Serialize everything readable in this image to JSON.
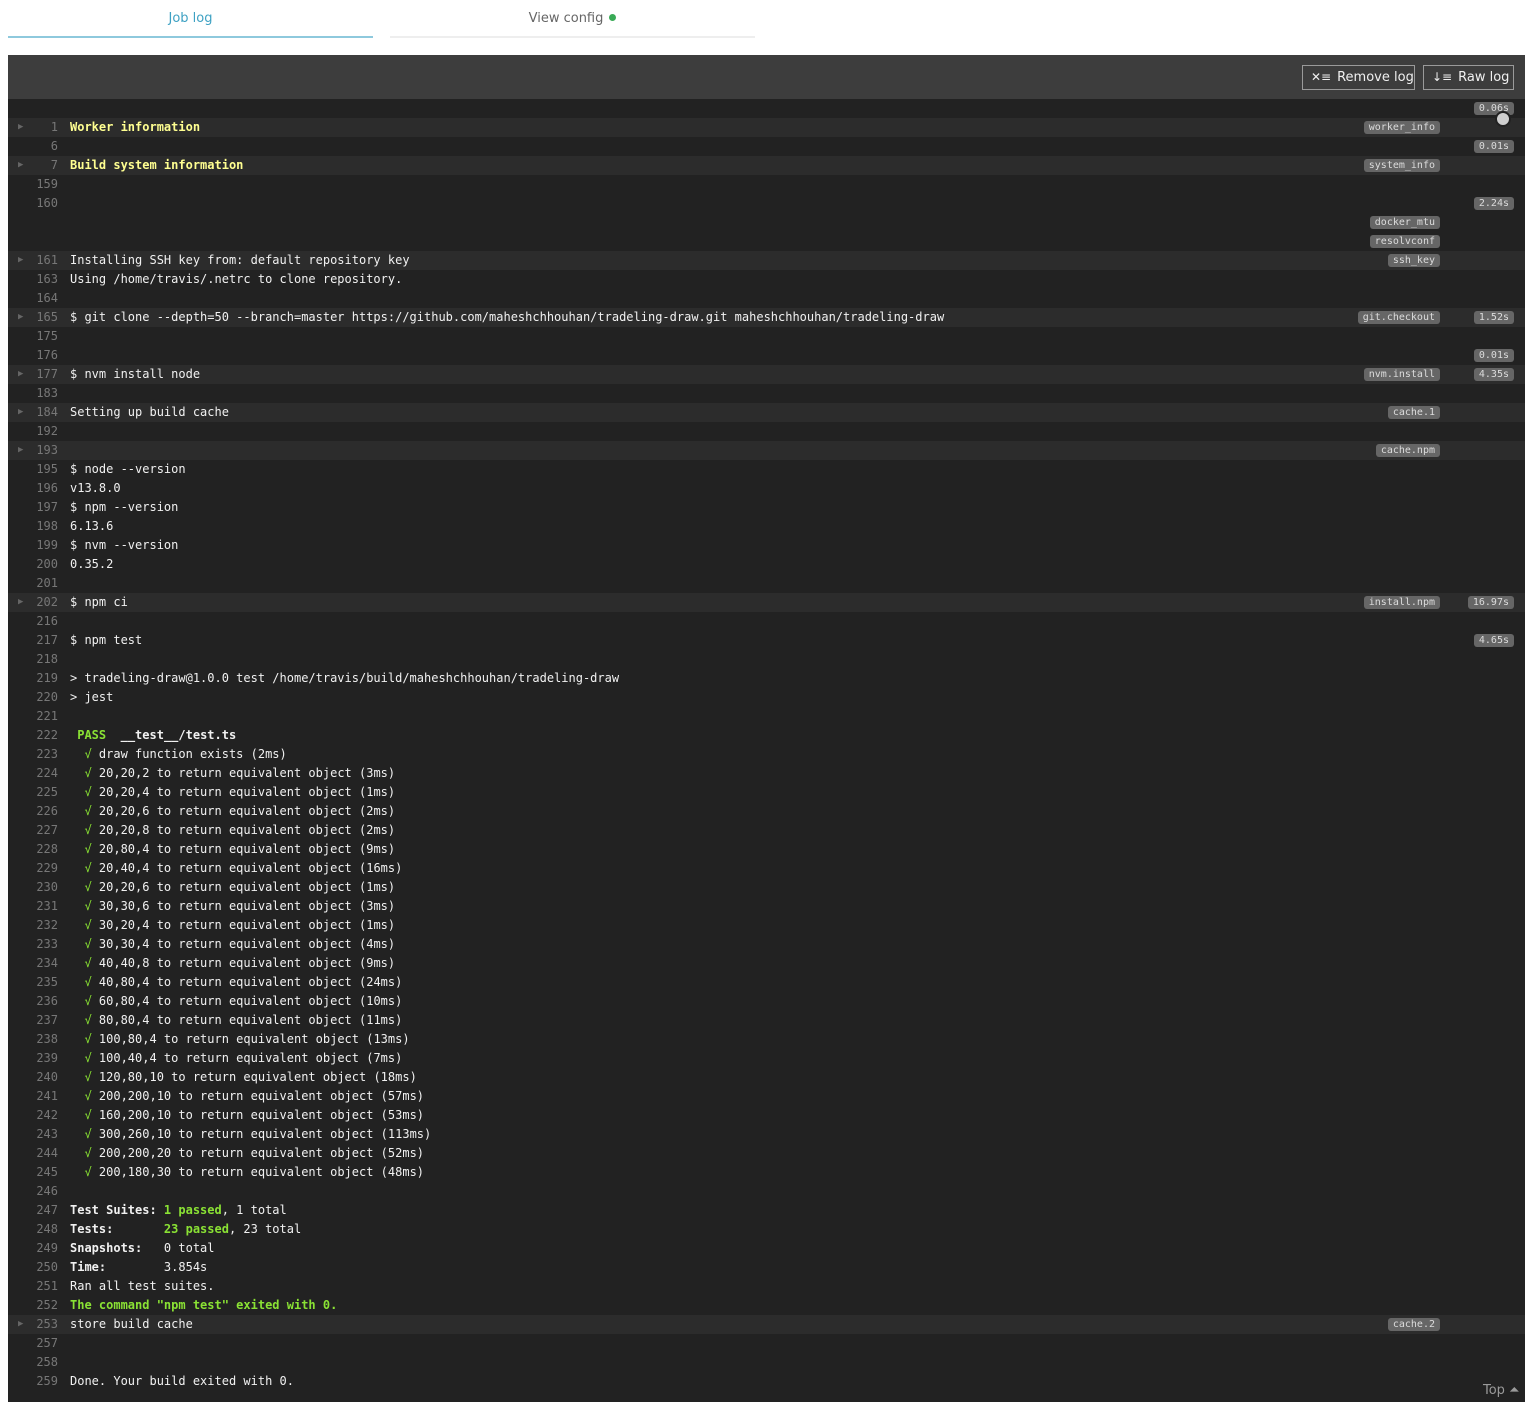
{
  "tabs": {
    "job_log": "Job log",
    "view_config": "View config"
  },
  "toolbar": {
    "remove_log": "Remove log",
    "raw_log": "Raw log"
  },
  "footer": {
    "top": "Top"
  },
  "lines": [
    {
      "n": "",
      "segs": [],
      "time": "0.06s"
    },
    {
      "n": "1",
      "fold": true,
      "segs": [
        {
          "t": "Worker information",
          "c": "yel"
        }
      ],
      "tag": "worker_info"
    },
    {
      "n": "6",
      "segs": [],
      "time": "0.01s"
    },
    {
      "n": "7",
      "fold": true,
      "segs": [
        {
          "t": "Build system information",
          "c": "yel"
        }
      ],
      "tag": "system_info"
    },
    {
      "n": "159",
      "segs": []
    },
    {
      "n": "160",
      "segs": [],
      "time": "2.24s"
    },
    {
      "n": "",
      "segs": [],
      "tag": "docker_mtu"
    },
    {
      "n": "",
      "segs": [],
      "tag": "resolvconf"
    },
    {
      "n": "161",
      "fold": true,
      "segs": [
        {
          "t": "Installing SSH key from: default repository key"
        }
      ],
      "tag": "ssh_key"
    },
    {
      "n": "163",
      "segs": [
        {
          "t": "Using /home/travis/.netrc to clone repository."
        }
      ]
    },
    {
      "n": "164",
      "segs": []
    },
    {
      "n": "165",
      "fold": true,
      "segs": [
        {
          "t": "$ git clone --depth=50 --branch=master https://github.com/maheshchhouhan/tradeling-draw.git maheshchhouhan/tradeling-draw"
        }
      ],
      "tag": "git.checkout",
      "time": "1.52s"
    },
    {
      "n": "175",
      "segs": []
    },
    {
      "n": "176",
      "segs": [],
      "time": "0.01s"
    },
    {
      "n": "177",
      "fold": true,
      "segs": [
        {
          "t": "$ nvm install node"
        }
      ],
      "tag": "nvm.install",
      "time": "4.35s"
    },
    {
      "n": "183",
      "segs": []
    },
    {
      "n": "184",
      "fold": true,
      "segs": [
        {
          "t": "Setting up build cache"
        }
      ],
      "tag": "cache.1"
    },
    {
      "n": "192",
      "segs": []
    },
    {
      "n": "193",
      "fold": true,
      "segs": [],
      "tag": "cache.npm"
    },
    {
      "n": "195",
      "segs": [
        {
          "t": "$ node --version"
        }
      ]
    },
    {
      "n": "196",
      "segs": [
        {
          "t": "v13.8.0"
        }
      ]
    },
    {
      "n": "197",
      "segs": [
        {
          "t": "$ npm --version"
        }
      ]
    },
    {
      "n": "198",
      "segs": [
        {
          "t": "6.13.6"
        }
      ]
    },
    {
      "n": "199",
      "segs": [
        {
          "t": "$ nvm --version"
        }
      ]
    },
    {
      "n": "200",
      "segs": [
        {
          "t": "0.35.2"
        }
      ]
    },
    {
      "n": "201",
      "segs": []
    },
    {
      "n": "202",
      "fold": true,
      "segs": [
        {
          "t": "$ npm ci"
        }
      ],
      "tag": "install.npm",
      "time": "16.97s"
    },
    {
      "n": "216",
      "segs": []
    },
    {
      "n": "217",
      "segs": [
        {
          "t": "$ npm test"
        }
      ],
      "time": "4.65s"
    },
    {
      "n": "218",
      "segs": []
    },
    {
      "n": "219",
      "segs": [
        {
          "t": "> tradeling-draw@1.0.0 test /home/travis/build/maheshchhouhan/tradeling-draw"
        }
      ]
    },
    {
      "n": "220",
      "segs": [
        {
          "t": "> jest"
        }
      ]
    },
    {
      "n": "221",
      "segs": []
    },
    {
      "n": "222",
      "segs": [
        {
          "t": " "
        },
        {
          "t": "PASS",
          "c": "grnb"
        },
        {
          "t": "  "
        },
        {
          "t": "__test__/test.ts",
          "c": "bold"
        }
      ]
    },
    {
      "n": "223",
      "segs": [
        {
          "t": "  "
        },
        {
          "t": "√",
          "c": "grn"
        },
        {
          "t": " draw function exists (2ms)"
        }
      ]
    },
    {
      "n": "224",
      "segs": [
        {
          "t": "  "
        },
        {
          "t": "√",
          "c": "grn"
        },
        {
          "t": " 20,20,2 to return equivalent object (3ms)"
        }
      ]
    },
    {
      "n": "225",
      "segs": [
        {
          "t": "  "
        },
        {
          "t": "√",
          "c": "grn"
        },
        {
          "t": " 20,20,4 to return equivalent object (1ms)"
        }
      ]
    },
    {
      "n": "226",
      "segs": [
        {
          "t": "  "
        },
        {
          "t": "√",
          "c": "grn"
        },
        {
          "t": " 20,20,6 to return equivalent object (2ms)"
        }
      ]
    },
    {
      "n": "227",
      "segs": [
        {
          "t": "  "
        },
        {
          "t": "√",
          "c": "grn"
        },
        {
          "t": " 20,20,8 to return equivalent object (2ms)"
        }
      ]
    },
    {
      "n": "228",
      "segs": [
        {
          "t": "  "
        },
        {
          "t": "√",
          "c": "grn"
        },
        {
          "t": " 20,80,4 to return equivalent object (9ms)"
        }
      ]
    },
    {
      "n": "229",
      "segs": [
        {
          "t": "  "
        },
        {
          "t": "√",
          "c": "grn"
        },
        {
          "t": " 20,40,4 to return equivalent object (16ms)"
        }
      ]
    },
    {
      "n": "230",
      "segs": [
        {
          "t": "  "
        },
        {
          "t": "√",
          "c": "grn"
        },
        {
          "t": " 20,20,6 to return equivalent object (1ms)"
        }
      ]
    },
    {
      "n": "231",
      "segs": [
        {
          "t": "  "
        },
        {
          "t": "√",
          "c": "grn"
        },
        {
          "t": " 30,30,6 to return equivalent object (3ms)"
        }
      ]
    },
    {
      "n": "232",
      "segs": [
        {
          "t": "  "
        },
        {
          "t": "√",
          "c": "grn"
        },
        {
          "t": " 30,20,4 to return equivalent object (1ms)"
        }
      ]
    },
    {
      "n": "233",
      "segs": [
        {
          "t": "  "
        },
        {
          "t": "√",
          "c": "grn"
        },
        {
          "t": " 30,30,4 to return equivalent object (4ms)"
        }
      ]
    },
    {
      "n": "234",
      "segs": [
        {
          "t": "  "
        },
        {
          "t": "√",
          "c": "grn"
        },
        {
          "t": " 40,40,8 to return equivalent object (9ms)"
        }
      ]
    },
    {
      "n": "235",
      "segs": [
        {
          "t": "  "
        },
        {
          "t": "√",
          "c": "grn"
        },
        {
          "t": " 40,80,4 to return equivalent object (24ms)"
        }
      ]
    },
    {
      "n": "236",
      "segs": [
        {
          "t": "  "
        },
        {
          "t": "√",
          "c": "grn"
        },
        {
          "t": " 60,80,4 to return equivalent object (10ms)"
        }
      ]
    },
    {
      "n": "237",
      "segs": [
        {
          "t": "  "
        },
        {
          "t": "√",
          "c": "grn"
        },
        {
          "t": " 80,80,4 to return equivalent object (11ms)"
        }
      ]
    },
    {
      "n": "238",
      "segs": [
        {
          "t": "  "
        },
        {
          "t": "√",
          "c": "grn"
        },
        {
          "t": " 100,80,4 to return equivalent object (13ms)"
        }
      ]
    },
    {
      "n": "239",
      "segs": [
        {
          "t": "  "
        },
        {
          "t": "√",
          "c": "grn"
        },
        {
          "t": " 100,40,4 to return equivalent object (7ms)"
        }
      ]
    },
    {
      "n": "240",
      "segs": [
        {
          "t": "  "
        },
        {
          "t": "√",
          "c": "grn"
        },
        {
          "t": " 120,80,10 to return equivalent object (18ms)"
        }
      ]
    },
    {
      "n": "241",
      "segs": [
        {
          "t": "  "
        },
        {
          "t": "√",
          "c": "grn"
        },
        {
          "t": " 200,200,10 to return equivalent object (57ms)"
        }
      ]
    },
    {
      "n": "242",
      "segs": [
        {
          "t": "  "
        },
        {
          "t": "√",
          "c": "grn"
        },
        {
          "t": " 160,200,10 to return equivalent object (53ms)"
        }
      ]
    },
    {
      "n": "243",
      "segs": [
        {
          "t": "  "
        },
        {
          "t": "√",
          "c": "grn"
        },
        {
          "t": " 300,260,10 to return equivalent object (113ms)"
        }
      ]
    },
    {
      "n": "244",
      "segs": [
        {
          "t": "  "
        },
        {
          "t": "√",
          "c": "grn"
        },
        {
          "t": " 200,200,20 to return equivalent object (52ms)"
        }
      ]
    },
    {
      "n": "245",
      "segs": [
        {
          "t": "  "
        },
        {
          "t": "√",
          "c": "grn"
        },
        {
          "t": " 200,180,30 to return equivalent object (48ms)"
        }
      ]
    },
    {
      "n": "246",
      "segs": []
    },
    {
      "n": "247",
      "segs": [
        {
          "t": "Test Suites: ",
          "c": "bold"
        },
        {
          "t": "1 passed",
          "c": "grnb"
        },
        {
          "t": ", 1 total"
        }
      ]
    },
    {
      "n": "248",
      "segs": [
        {
          "t": "Tests:       ",
          "c": "bold"
        },
        {
          "t": "23 passed",
          "c": "grnb"
        },
        {
          "t": ", 23 total"
        }
      ]
    },
    {
      "n": "249",
      "segs": [
        {
          "t": "Snapshots:   ",
          "c": "bold"
        },
        {
          "t": "0 total"
        }
      ]
    },
    {
      "n": "250",
      "segs": [
        {
          "t": "Time:        ",
          "c": "bold"
        },
        {
          "t": "3.854s"
        }
      ]
    },
    {
      "n": "251",
      "segs": [
        {
          "t": "Ran all test suites."
        }
      ]
    },
    {
      "n": "252",
      "segs": [
        {
          "t": "The command \"npm test\" exited with 0.",
          "c": "grnb"
        }
      ]
    },
    {
      "n": "253",
      "fold": true,
      "segs": [
        {
          "t": "store build cache"
        }
      ],
      "tag": "cache.2"
    },
    {
      "n": "257",
      "segs": []
    },
    {
      "n": "258",
      "segs": []
    },
    {
      "n": "259",
      "segs": [
        {
          "t": "Done. Your build exited with 0."
        }
      ]
    }
  ]
}
